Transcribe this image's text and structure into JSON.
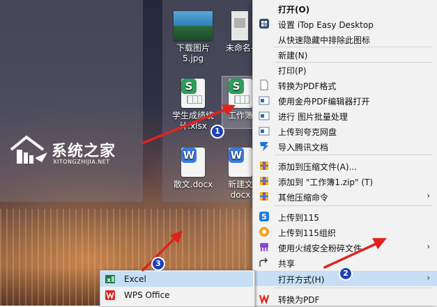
{
  "desktop": {
    "icons": [
      {
        "label1": "下载图片",
        "label2": "5.jpg"
      },
      {
        "label1": "未命名-",
        "label2": ""
      },
      {
        "label1": "学生成绩统",
        "label2": "计.xlsx"
      },
      {
        "label1": "工作簿",
        "label2": ""
      },
      {
        "label1": "散文.docx",
        "label2": ""
      },
      {
        "label1": "新建文",
        "label2": "docx"
      }
    ]
  },
  "watermark": {
    "title": "系统之家",
    "subtitle": "XITONGZHIJIA.NET"
  },
  "context_menu": {
    "items": [
      {
        "label": "打开(O)",
        "bold": true
      },
      {
        "label": "设置 iTop Easy Desktop"
      },
      {
        "label": "从快速隐藏中排除此图标"
      },
      {
        "label": "新建(N)"
      },
      {
        "label": "打印(P)"
      },
      {
        "label": "转换为PDF格式"
      },
      {
        "label": "使用金舟PDF编辑器打开"
      },
      {
        "label": "进行 图片批量处理"
      },
      {
        "label": "上传到夸克网盘"
      },
      {
        "label": "导入腾讯文档"
      },
      {
        "label": "添加到压缩文件(A)..."
      },
      {
        "label": "添加到 \"工作簿1.zip\" (T)"
      },
      {
        "label": "其他压缩命令"
      },
      {
        "label": "上传到115"
      },
      {
        "label": "上传到115组织"
      },
      {
        "label": "使用火绒安全粉碎文件"
      },
      {
        "label": "共享"
      },
      {
        "label": "打开方式(H)"
      },
      {
        "label": "转换为PDF"
      }
    ],
    "submenu_arrow": "›"
  },
  "submenu": {
    "items": [
      {
        "label": "Excel"
      },
      {
        "label": "WPS Office"
      }
    ]
  },
  "badges": {
    "one": "1",
    "two": "2",
    "three": "3"
  },
  "colors": {
    "highlight": "#c6dff6",
    "badge": "#1d3fb8",
    "arrow": "#e0231c",
    "wps_green": "#2e9e5b",
    "word_blue": "#3a7be0"
  }
}
